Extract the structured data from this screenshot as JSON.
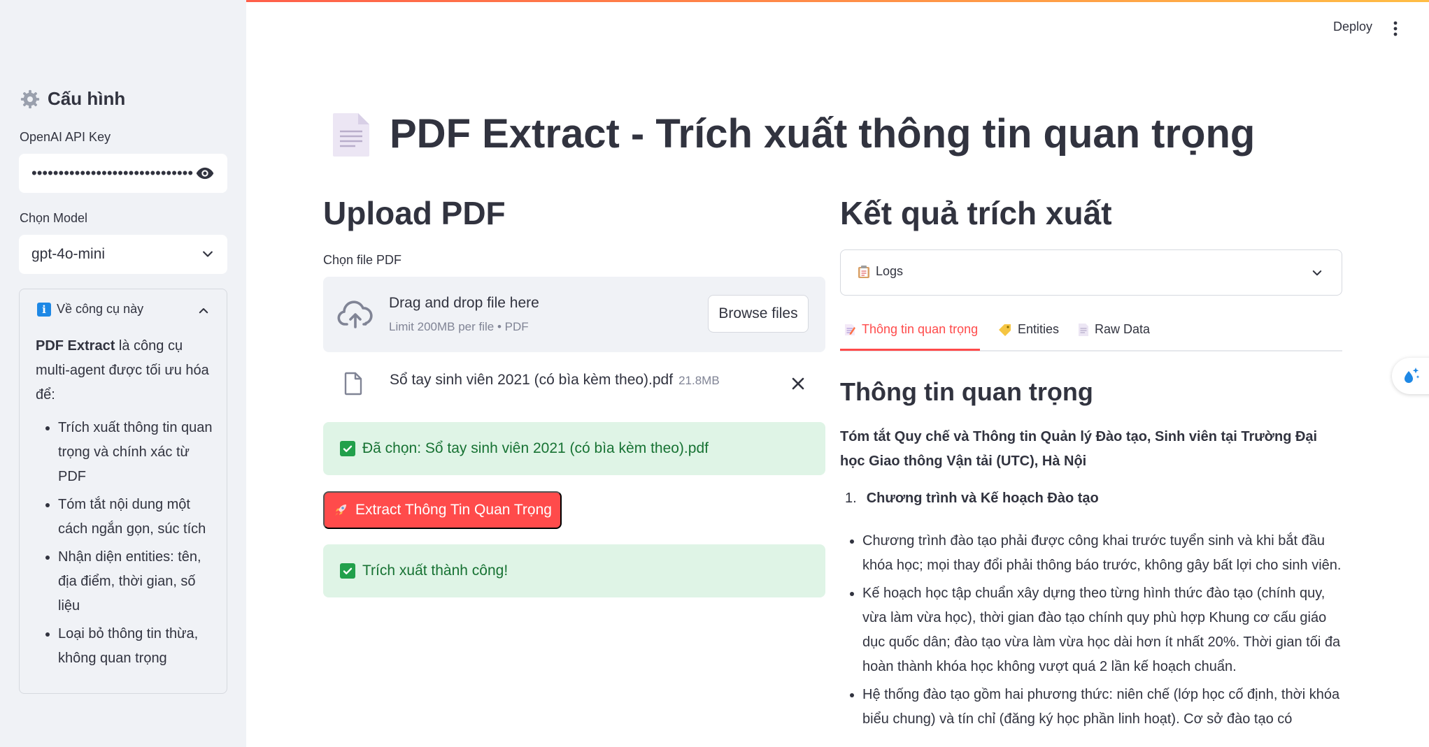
{
  "header": {
    "deploy_label": "Deploy"
  },
  "sidebar": {
    "title": "Cấu hình",
    "api_key_label": "OpenAI API Key",
    "api_key_value": "••••••••••••••••••••••••••••••",
    "model_label": "Chọn Model",
    "model_value": "gpt-4o-mini",
    "about": {
      "title": "Về công cụ này",
      "intro_bold": "PDF Extract",
      "intro_rest": " là công cụ multi-agent được tối ưu hóa để:",
      "items": [
        "Trích xuất thông tin quan trọng và chính xác từ PDF",
        "Tóm tắt nội dung một cách ngắn gọn, súc tích",
        "Nhận diện entities: tên, địa điểm, thời gian, số liệu",
        "Loại bỏ thông tin thừa, không quan trọng"
      ]
    }
  },
  "main": {
    "title": "PDF Extract - Trích xuất thông tin quan trọng",
    "upload": {
      "heading": "Upload PDF",
      "field_label": "Chọn file PDF",
      "drop_title": "Drag and drop file here",
      "drop_sub": "Limit 200MB per file • PDF",
      "browse_label": "Browse files",
      "file_name": "Sổ tay sinh viên 2021 (có bìa kèm theo).pdf",
      "file_size": "21.8MB",
      "selected_msg": "Đã chọn: Sổ tay sinh viên 2021 (có bìa kèm theo).pdf",
      "extract_label": "Extract Thông Tin Quan Trọng",
      "success_msg": "Trích xuất thành công!"
    },
    "result": {
      "heading": "Kết quả trích xuất",
      "logs_label": "Logs",
      "tabs": [
        {
          "label": "Thông tin quan trọng"
        },
        {
          "label": "Entities"
        },
        {
          "label": "Raw Data"
        }
      ],
      "section_title": "Thông tin quan trọng",
      "summary": "Tóm tắt Quy chế và Thông tin Quản lý Đào tạo, Sinh viên tại Trường Đại học Giao thông Vận tải (UTC), Hà Nội",
      "ol_number": "1.",
      "ol_title": "Chương trình và Kế hoạch Đào tạo",
      "bullets": [
        "Chương trình đào tạo phải được công khai trước tuyển sinh và khi bắt đầu khóa học; mọi thay đổi phải thông báo trước, không gây bất lợi cho sinh viên.",
        "Kế hoạch học tập chuẩn xây dựng theo từng hình thức đào tạo (chính quy, vừa làm vừa học), thời gian đào tạo chính quy phù hợp Khung cơ cấu giáo dục quốc dân; đào tạo vừa làm vừa học dài hơn ít nhất 20%. Thời gian tối đa hoàn thành khóa học không vượt quá 2 lần kế hoạch chuẩn.",
        "Hệ thống đào tạo gồm hai phương thức: niên chế (lớp học cố định, thời khóa biểu chung) và tín chỉ (đăng ký học phần linh hoạt). Cơ sở đào tạo có"
      ]
    }
  },
  "colors": {
    "accent": "#ff4b4b",
    "success_bg": "#dff4e6",
    "success_text": "#177233",
    "sidebar_bg": "#f0f2f6"
  }
}
